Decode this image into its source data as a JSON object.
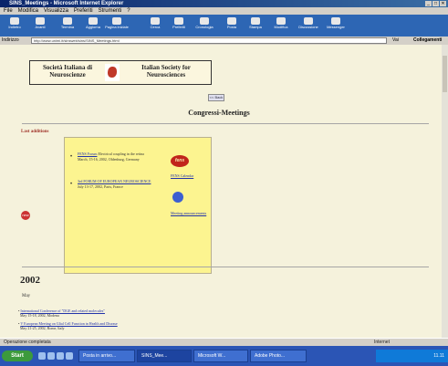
{
  "window": {
    "title": "SINS_Meetings - Microsoft Internet Explorer",
    "controls": [
      "_",
      "□",
      "✕"
    ]
  },
  "menu": {
    "items": [
      "File",
      "Modifica",
      "Visualizza",
      "Preferiti",
      "Strumenti",
      "?"
    ]
  },
  "toolbar": {
    "buttons": [
      "Indietro",
      "Avanti",
      "Termina",
      "Aggiorna",
      "Pagina iniziale",
      "Cerca",
      "Preferiti",
      "Cronologia",
      "Posta",
      "Stampa",
      "Modifica",
      "Discussione",
      "Messenger"
    ]
  },
  "address": {
    "label": "Indirizzo",
    "url": "http://www.unimi.it/sinsweb/sins/SINS_Meetings.html",
    "go": "Vai",
    "links": "Collegamenti"
  },
  "page": {
    "society_it": "Società Italiana di Neuroscienze",
    "society_en": "Italian Society for Neurosciences",
    "back_label": "<< Back",
    "title": "Congressi-Meetings",
    "last_additions": "Last additions",
    "updates": [
      {
        "link": "FENS Forum",
        "text": "Electrical coupling in the retina",
        "detail": "March, 15-16, 2002, Oldenburg, Germany"
      },
      {
        "link": "3rd FORUM OF EUROPEAN NEUROSCIENCE",
        "text": "",
        "detail": "July 13-17, 2002, Paris, France"
      }
    ],
    "sie_logo_text": "fens",
    "sie_calendar": "FENS Calendar",
    "meeting_announcements": "Meeting announcements",
    "new_badge": "new",
    "year": "2002",
    "month": "May",
    "events": [
      {
        "link": "International Conference of \"DGE and related molecules\"",
        "detail": "May 15-18, 2002, Modena"
      },
      {
        "link": "V European Meeting on Glial Cell Function in Health and Disease",
        "detail": "May 21-25, 2002, Rome, Italy"
      }
    ]
  },
  "status": {
    "left": "Operazione completata",
    "zone": "Internet"
  },
  "taskbar": {
    "start": "Start",
    "tasks": [
      "Posta in arrivo...",
      "SINS_Mee...",
      "Microsoft W...",
      "Adobe Photo..."
    ],
    "clock": "11.11"
  }
}
